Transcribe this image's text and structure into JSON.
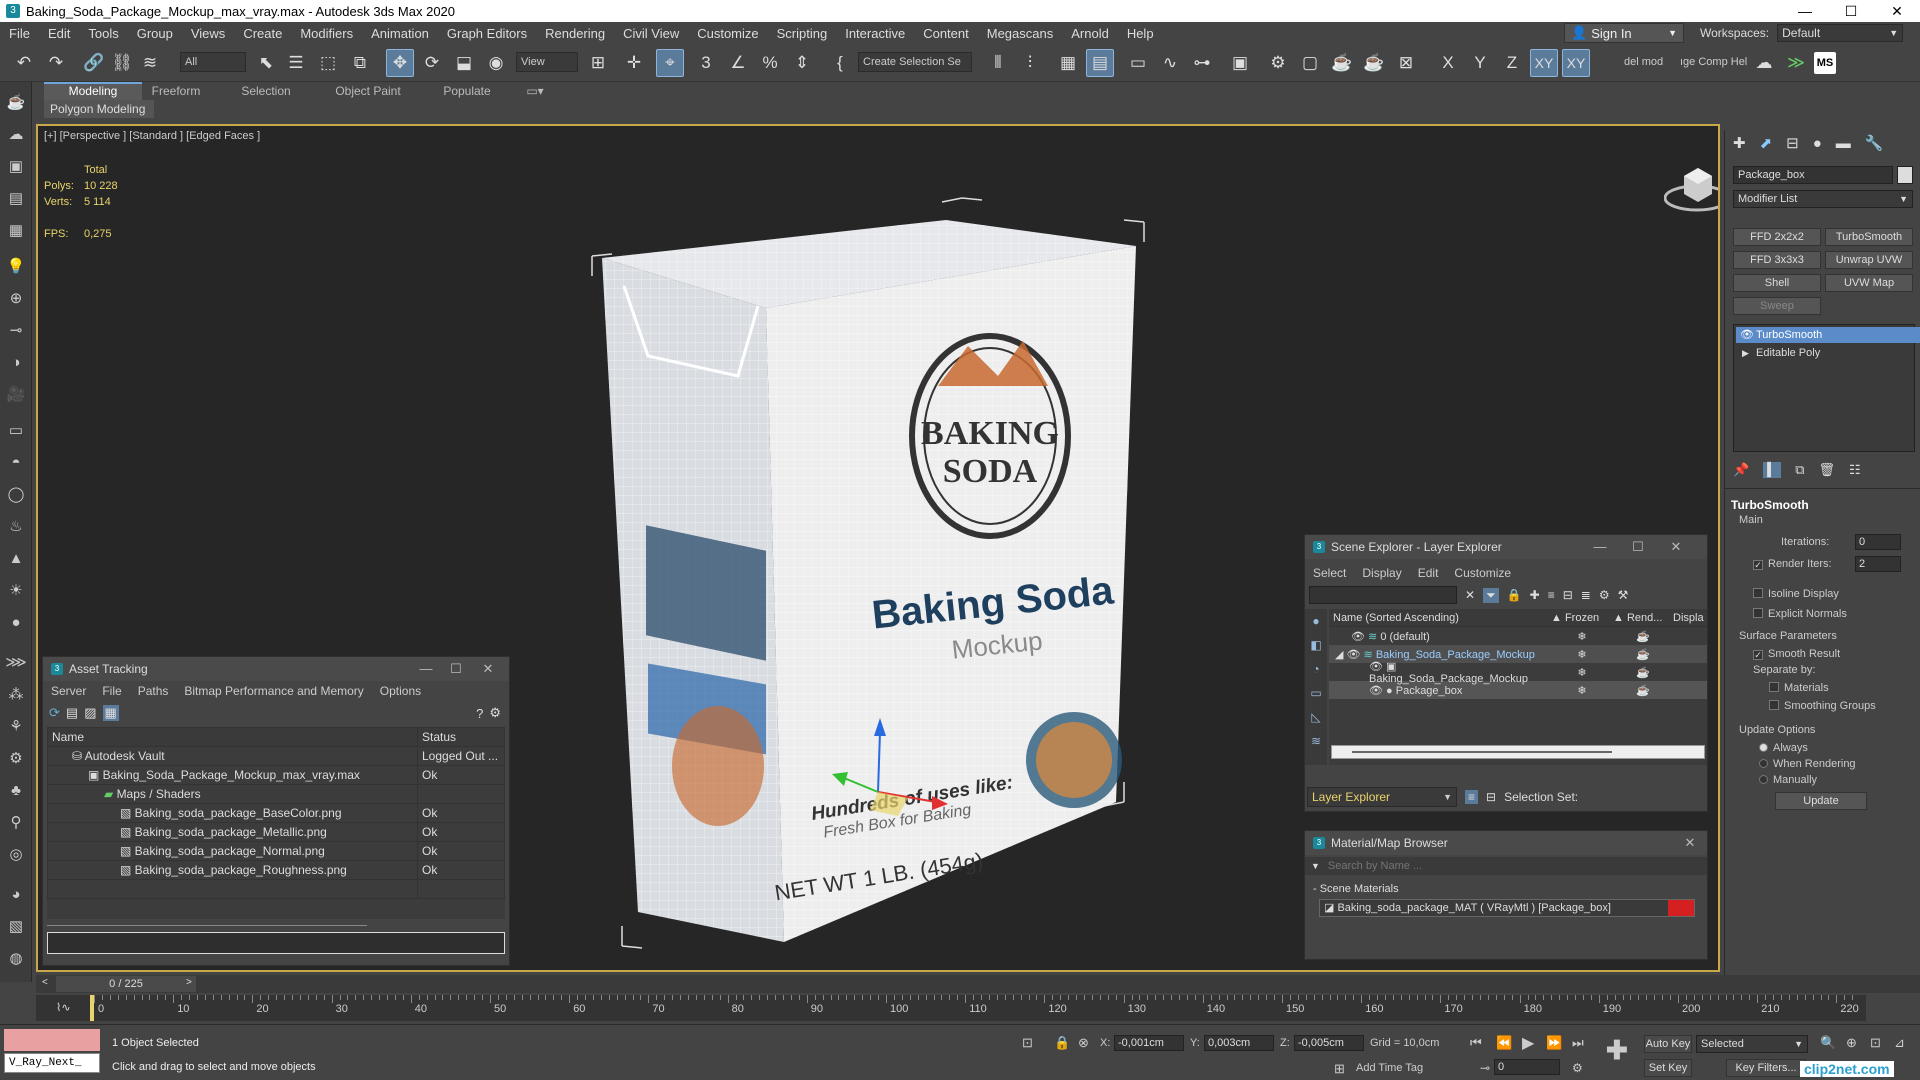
{
  "window": {
    "title": "Baking_Soda_Package_Mockup_max_vray.max - Autodesk 3ds Max 2020",
    "app_icon": "3",
    "min": "—",
    "max": "☐",
    "close": "✕"
  },
  "menu": [
    "File",
    "Edit",
    "Tools",
    "Group",
    "Views",
    "Create",
    "Modifiers",
    "Animation",
    "Graph Editors",
    "Rendering",
    "Civil View",
    "Customize",
    "Scripting",
    "Interactive",
    "Content",
    "Megascans",
    "Arnold",
    "Help"
  ],
  "sign_in": "Sign In",
  "workspaces": {
    "label": "Workspaces:",
    "value": "Default"
  },
  "toolbar": {
    "filter": "All",
    "view": "View",
    "selection_set": "Create Selection Se",
    "axes": [
      "X",
      "Y",
      "Z",
      "XY",
      "XY"
    ],
    "del_mod": "del mod",
    "comp_help": "ıge Comp Hel",
    "ms": "MS"
  },
  "ribbon": {
    "tabs": [
      "Modeling",
      "Freeform",
      "Selection",
      "Object Paint",
      "Populate"
    ],
    "active": "Modeling",
    "sub": "Polygon Modeling"
  },
  "viewport": {
    "label": "[+] [Perspective ] [Standard ] [Edged Faces ]",
    "stats": {
      "total": "Total",
      "polys_k": "Polys:",
      "polys_v": "10 228",
      "verts_k": "Verts:",
      "verts_v": "5 114",
      "fps_k": "FPS:",
      "fps_v": "0,275"
    },
    "box": {
      "logo_line1": "BAKING",
      "logo_line2": "SODA",
      "title": "Baking Soda",
      "subtitle": "Mockup",
      "uses": "Hundreds of uses like:",
      "fresh": "Fresh Box for Baking",
      "net": "NET WT 1 LB. (454g)"
    }
  },
  "asset_tracking": {
    "title": "Asset Tracking",
    "menu": [
      "Server",
      "File",
      "Paths",
      "Bitmap Performance and Memory",
      "Options"
    ],
    "columns": [
      "Name",
      "Status"
    ],
    "rows": [
      {
        "name": "Autodesk Vault",
        "status": "Logged Out ...",
        "indent": 0
      },
      {
        "name": "Baking_Soda_Package_Mockup_max_vray.max",
        "status": "Ok",
        "indent": 1
      },
      {
        "name": "Maps / Shaders",
        "status": "",
        "indent": 2
      },
      {
        "name": "Baking_soda_package_BaseColor.png",
        "status": "Ok",
        "indent": 3
      },
      {
        "name": "Baking_soda_package_Metallic.png",
        "status": "Ok",
        "indent": 3
      },
      {
        "name": "Baking_soda_package_Normal.png",
        "status": "Ok",
        "indent": 3
      },
      {
        "name": "Baking_soda_package_Roughness.png",
        "status": "Ok",
        "indent": 3
      }
    ]
  },
  "scene_explorer": {
    "title": "Scene Explorer - Layer Explorer",
    "menu": [
      "Select",
      "Display",
      "Edit",
      "Customize"
    ],
    "columns": [
      "Name (Sorted Ascending)",
      "▲ Frozen",
      "▲ Rend...",
      "Displa"
    ],
    "rows": [
      {
        "name": "0 (default)",
        "indent": 0,
        "selected": false
      },
      {
        "name": "Baking_Soda_Package_Mockup",
        "indent": 0,
        "selected": true
      },
      {
        "name": "Baking_Soda_Package_Mockup",
        "indent": 1,
        "selected": false
      },
      {
        "name": "Package_box",
        "indent": 1,
        "selected": true
      }
    ],
    "footer_dropdown": "Layer Explorer",
    "selection_set": "Selection Set:"
  },
  "material_browser": {
    "title": "Material/Map Browser",
    "search_placeholder": "Search by Name ...",
    "group": "- Scene Materials",
    "item": "Baking_soda_package_MAT ( VRayMtl ) [Package_box]",
    "item_color": "#d42020"
  },
  "command_panel": {
    "object_name": "Package_box",
    "modifier_list": "Modifier List",
    "buttons": [
      "FFD 2x2x2",
      "TurboSmooth",
      "FFD 3x3x3",
      "Unwrap UVW",
      "Shell",
      "UVW Map",
      "Sweep"
    ],
    "stack": [
      "TurboSmooth",
      "Editable Poly"
    ],
    "rollout": "TurboSmooth",
    "main": "Main",
    "iterations_label": "Iterations:",
    "iterations": "0",
    "render_iters_label": "Render Iters:",
    "render_iters": "2",
    "isoline": "Isoline Display",
    "explicit_normals": "Explicit Normals",
    "surface_params": "Surface Parameters",
    "smooth_result": "Smooth Result",
    "separate_by": "Separate by:",
    "materials": "Materials",
    "smoothing_groups": "Smoothing Groups",
    "update_options": "Update Options",
    "always": "Always",
    "when_rendering": "When Rendering",
    "manually": "Manually",
    "update": "Update"
  },
  "timeline": {
    "frame": "0 / 225",
    "ticks": [
      "0",
      "10",
      "20",
      "30",
      "40",
      "50",
      "60",
      "70",
      "80",
      "90",
      "100",
      "110",
      "120",
      "130",
      "140",
      "150",
      "160",
      "170",
      "180",
      "190",
      "200",
      "210",
      "220"
    ]
  },
  "status": {
    "maxscript": "V_Ray_Next_",
    "selected": "1 Object Selected",
    "hint": "Click and drag to select and move objects",
    "x_label": "X:",
    "x": "-0,001cm",
    "y_label": "Y:",
    "y": "0,003cm",
    "z_label": "Z:",
    "z": "-0,005cm",
    "grid": "Grid = 10,0cm",
    "add_time_tag": "Add Time Tag",
    "auto_key": "Auto Key",
    "set_key": "Set Key",
    "key_mode": "Selected",
    "key_filters": "Key Filters...",
    "frame_input": "0",
    "watermark": "clip2net.com"
  },
  "colors": {
    "accent": "#6da5dc",
    "viewport_border": "#c8a84a",
    "stats": "#e8d46a",
    "selection": "#5b8bc9"
  }
}
